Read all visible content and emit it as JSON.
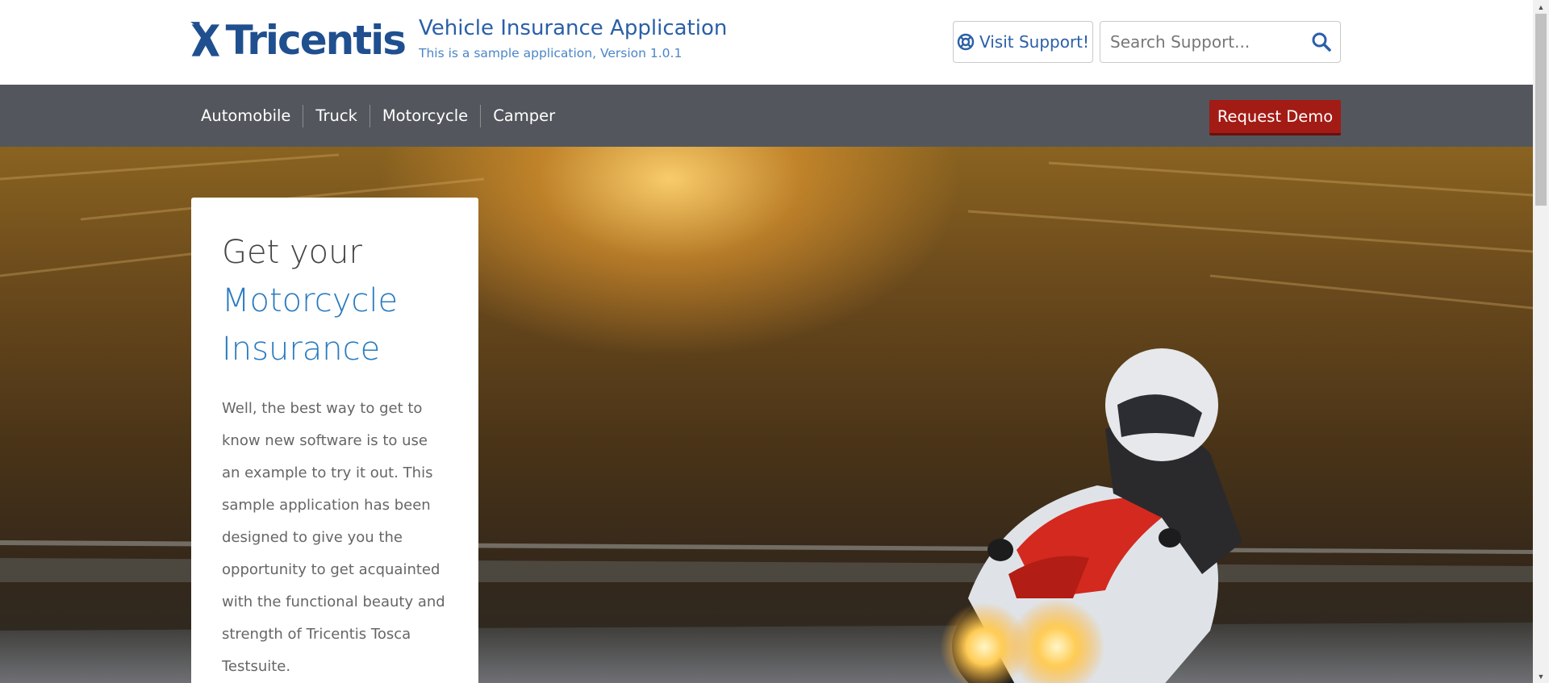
{
  "brand": {
    "logo_text": "Tricentis",
    "app_title": "Vehicle Insurance Application",
    "app_subtitle": "This is a sample application, Version 1.0.1",
    "color": "#1f4f8f"
  },
  "header": {
    "support_label": "Visit Support!",
    "support_icon": "lifebuoy-icon",
    "search_placeholder": "Search Support...",
    "search_icon": "search-icon"
  },
  "nav": {
    "items": [
      {
        "label": "Automobile"
      },
      {
        "label": "Truck"
      },
      {
        "label": "Motorcycle"
      },
      {
        "label": "Camper"
      }
    ],
    "demo_label": "Request Demo",
    "demo_color": "#a31b15"
  },
  "hero": {
    "heading_line1": "Get your",
    "heading_line2": "Motorcycle",
    "heading_line3": "Insurance",
    "accent_color": "#2a7bc0",
    "body": "Well, the best way to get to know new software is to use an example to try it out. This sample application has been designed to give you the opportunity to get acquainted with the functional beauty and strength of Tricentis Tosca Testsuite.",
    "image": "motorcycle-rider-image"
  },
  "scrollbar": {
    "up_glyph": "▲",
    "down_glyph": "▼"
  }
}
